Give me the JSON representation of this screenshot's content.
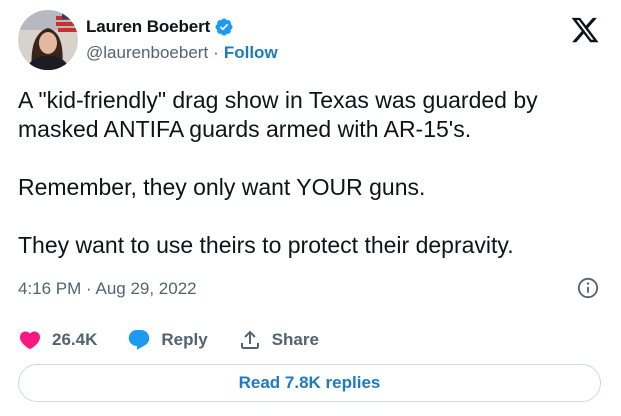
{
  "author": {
    "display_name": "Lauren Boebert",
    "handle": "@laurenboebert",
    "separator": "·",
    "follow_label": "Follow",
    "verified_icon": "verified-badge-icon",
    "avatar": "avatar-photo"
  },
  "brand": {
    "logo_icon": "x-logo-icon"
  },
  "tweet": {
    "paragraphs": [
      "A \"kid-friendly\" drag show in Texas was guarded by masked ANTIFA guards armed with AR-15's.",
      "Remember, they only want YOUR guns.",
      "They want to use theirs to protect their depravity."
    ],
    "timestamp": "4:16 PM · Aug 29, 2022"
  },
  "actions": {
    "like": {
      "icon": "heart-icon",
      "label": "26.4K"
    },
    "reply": {
      "icon": "reply-bubble-icon",
      "label": "Reply"
    },
    "share": {
      "icon": "share-icon",
      "label": "Share"
    }
  },
  "read_replies": {
    "label": "Read 7.8K replies"
  },
  "colors": {
    "link_blue": "#1d7bc2",
    "verified_blue": "#1d9bf0",
    "heart_pink": "#f91880",
    "muted_text": "#536471",
    "border": "#cfd9de"
  }
}
